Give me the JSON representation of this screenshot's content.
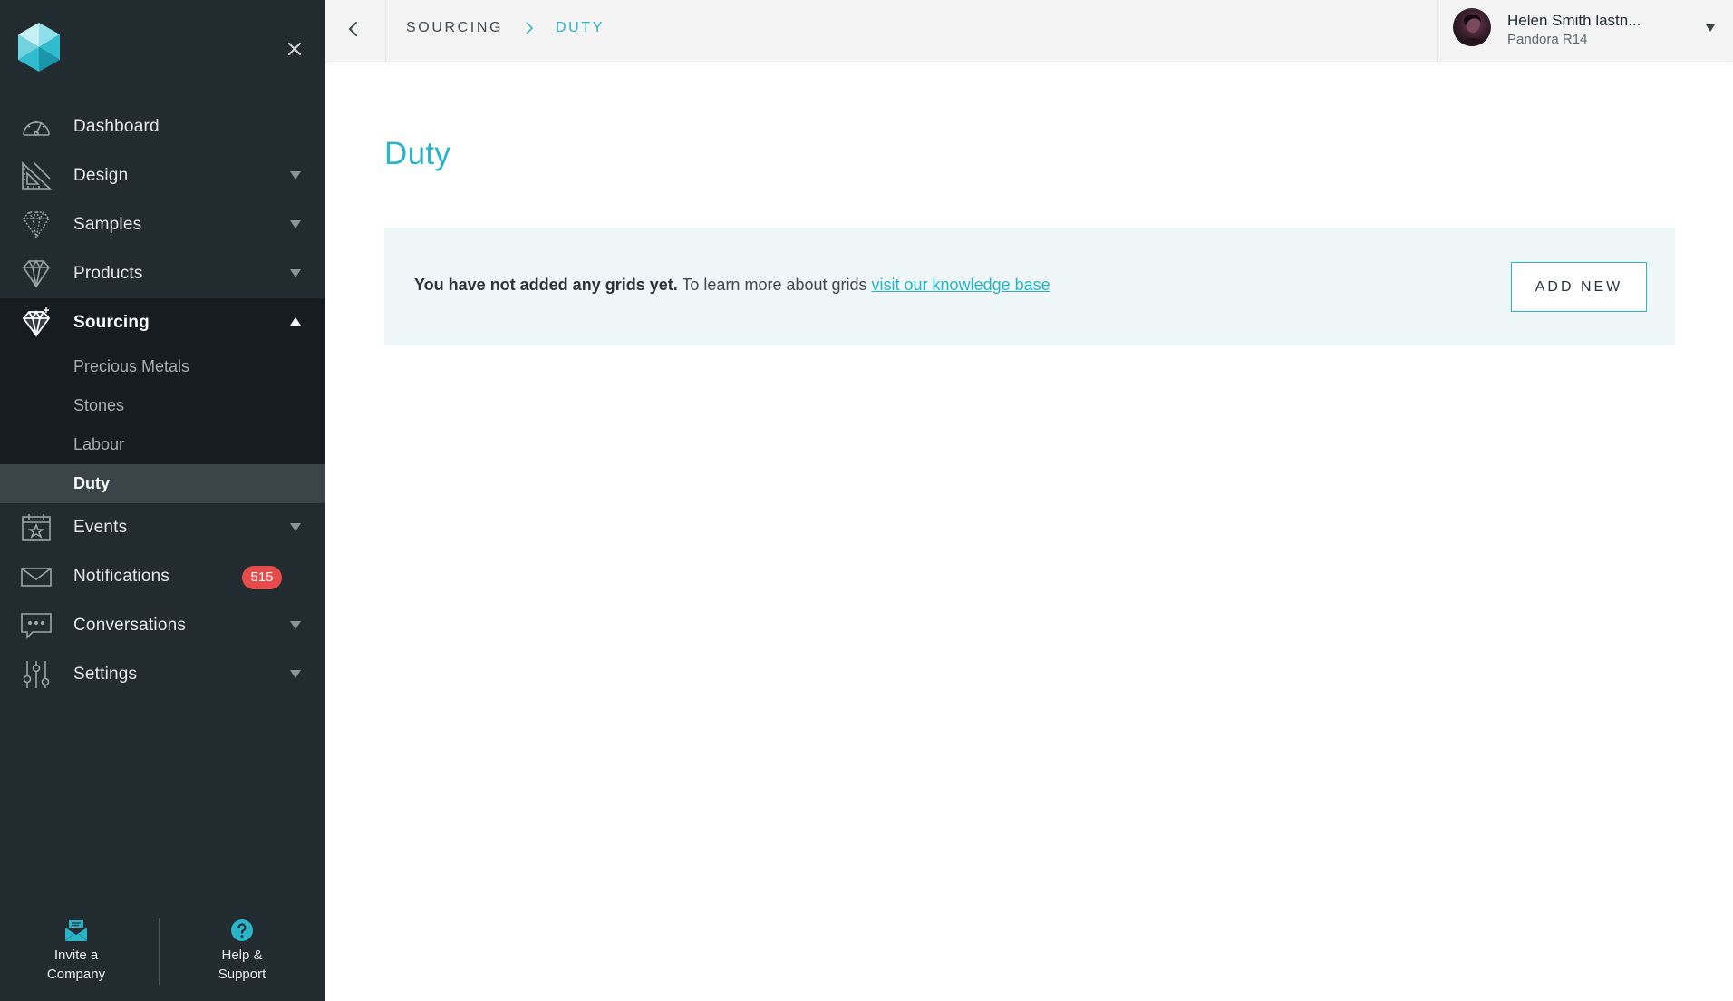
{
  "sidebar": {
    "nav": [
      {
        "id": "dashboard",
        "label": "Dashboard"
      },
      {
        "id": "design",
        "label": "Design"
      },
      {
        "id": "samples",
        "label": "Samples"
      },
      {
        "id": "products",
        "label": "Products"
      },
      {
        "id": "sourcing",
        "label": "Sourcing",
        "expanded": true,
        "children": [
          {
            "label": "Precious Metals"
          },
          {
            "label": "Stones"
          },
          {
            "label": "Labour"
          },
          {
            "label": "Duty",
            "active": true
          }
        ]
      },
      {
        "id": "events",
        "label": "Events"
      },
      {
        "id": "notifications",
        "label": "Notifications",
        "badge": "515"
      },
      {
        "id": "conversations",
        "label": "Conversations"
      },
      {
        "id": "settings",
        "label": "Settings"
      }
    ],
    "footer": {
      "invite": {
        "line1": "Invite a",
        "line2": "Company"
      },
      "help": {
        "line1": "Help &",
        "line2": "Support"
      }
    }
  },
  "topbar": {
    "breadcrumb": [
      "SOURCING",
      "DUTY"
    ],
    "user": {
      "name": "Helen Smith lastn...",
      "org": "Pandora R14"
    }
  },
  "main": {
    "title": "Duty",
    "empty_state": {
      "bold": "You have not added any grids yet.",
      "text": " To learn more about grids ",
      "link": "visit our knowledge base",
      "button": "ADD NEW"
    }
  },
  "colors": {
    "accent": "#2ab4c7",
    "sidebar_bg": "#212b30",
    "badge": "#e64b4b",
    "panel_bg": "#eef6f8"
  }
}
